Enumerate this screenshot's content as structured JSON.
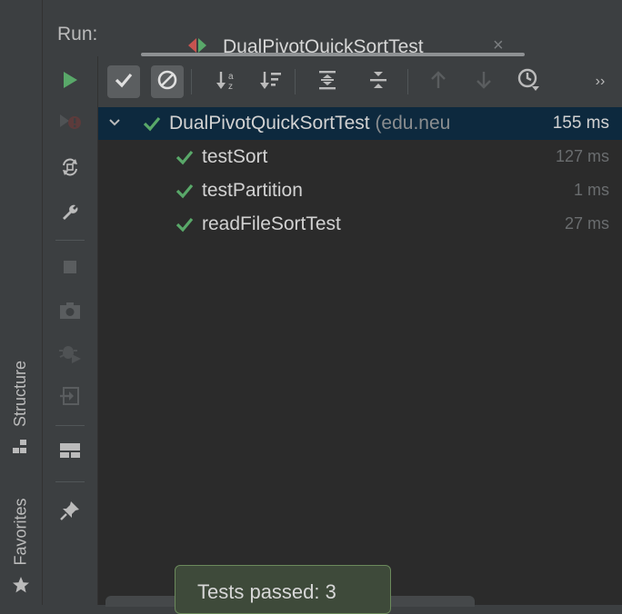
{
  "header": {
    "run_label": "Run:",
    "tab_title": "DualPivotQuickSortTest",
    "tab_close": "×"
  },
  "left_stripe": {
    "structure_label": "Structure",
    "favorites_label": "Favorites"
  },
  "toolbar": {
    "more_label": "››"
  },
  "tree": {
    "root": {
      "name": "DualPivotQuickSortTest",
      "package": "(edu.neu",
      "time": "155 ms"
    },
    "children": [
      {
        "name": "testSort",
        "time": "127 ms"
      },
      {
        "name": "testPartition",
        "time": "1 ms"
      },
      {
        "name": "readFileSortTest",
        "time": "27 ms"
      }
    ]
  },
  "toast": {
    "text": "Tests passed: 3"
  },
  "colors": {
    "background": "#3c3f41",
    "tree_background": "#2b2b2b",
    "selection": "#0d293e",
    "pass_green": "#59a869",
    "text": "#d2d2d2",
    "muted": "#6a6d6f"
  }
}
